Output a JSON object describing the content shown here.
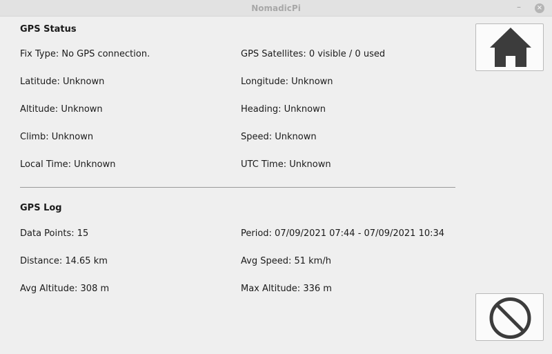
{
  "window": {
    "title": "NomadicPi",
    "minimize_glyph": "–",
    "close_glyph": "×"
  },
  "gps_status": {
    "heading": "GPS Status",
    "fix_type": "Fix Type: No GPS connection.",
    "satellites": "GPS Satellites: 0 visible / 0 used",
    "latitude": "Latitude: Unknown",
    "longitude": "Longitude: Unknown",
    "altitude": "Altitude: Unknown",
    "heading_value": "Heading: Unknown",
    "climb": "Climb: Unknown",
    "speed": "Speed: Unknown",
    "local_time": "Local Time: Unknown",
    "utc_time": "UTC Time: Unknown"
  },
  "gps_log": {
    "heading": "GPS Log",
    "data_points": "Data Points: 15",
    "period": "Period: 07/09/2021 07:44 - 07/09/2021 10:34",
    "distance": "Distance: 14.65 km",
    "avg_speed": "Avg Speed: 51 km/h",
    "avg_altitude": "Avg Altitude: 308 m",
    "max_altitude": "Max Altitude: 336 m"
  },
  "buttons": {
    "home_icon": "home-icon",
    "stop_icon": "no-entry-icon",
    "icon_color": "#3c3c3c"
  }
}
